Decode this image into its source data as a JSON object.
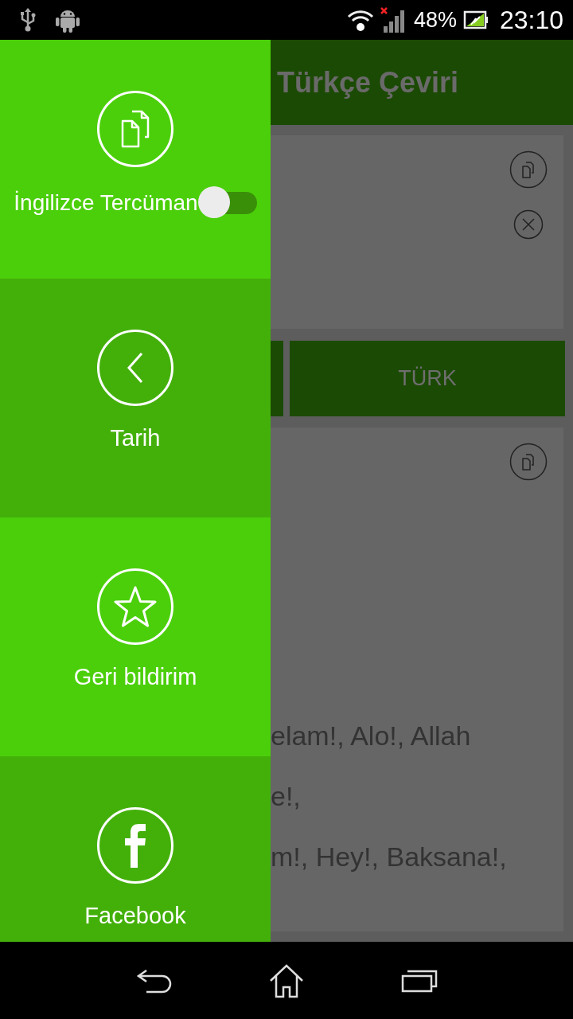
{
  "status_bar": {
    "battery": "48%",
    "time": "23:10"
  },
  "drawer": {
    "items": [
      {
        "label": "İngilizce Tercüman",
        "toggle": {
          "on": false
        }
      },
      {
        "label": "Tarih"
      },
      {
        "label": "Geri bildirim"
      },
      {
        "label": "Facebook"
      }
    ]
  },
  "app_bar": {
    "title": "Türkçe Çeviri"
  },
  "language_buttons": [
    {
      "label": "TÜRK"
    }
  ],
  "result_lines": [
    "elam!, Alo!, Allah",
    "e!,",
    "m!, Hey!, Baksana!,"
  ]
}
